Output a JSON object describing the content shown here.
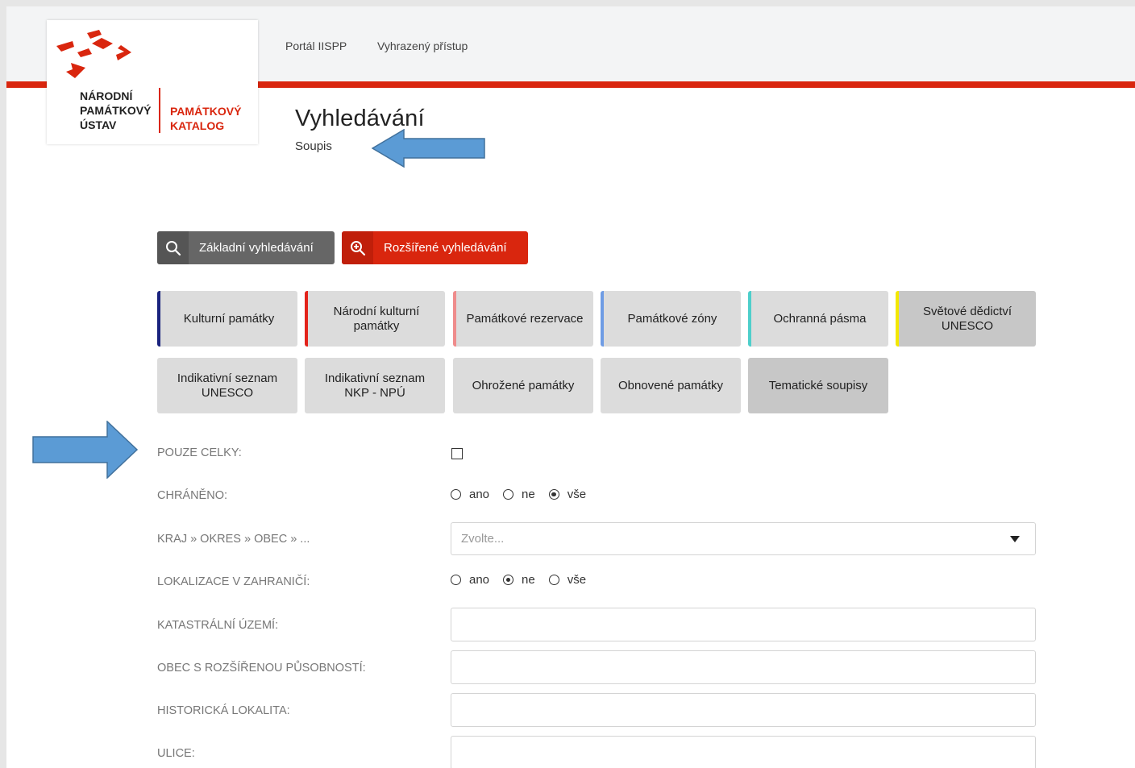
{
  "colors": {
    "brand_red": "#d9260e",
    "topbar_bg": "#f3f4f5",
    "callout_arrow": "#5b9bd5",
    "tile_bg": "#dcdcdc",
    "tile_dark_bg": "#c7c7c7"
  },
  "logo": {
    "line1": "NÁRODNÍ",
    "line2": "PAMÁTKOVÝ",
    "line3": "ÚSTAV",
    "sub1": "PAMÁTKOVÝ",
    "sub2": "KATALOG",
    "icon": "npu-logo-mark"
  },
  "nav": {
    "portal": "Portál IISPP",
    "restricted": "Vyhrazený přístup"
  },
  "header": {
    "title": "Vyhledávání",
    "subtitle": "Soupis"
  },
  "search_modes": {
    "basic": {
      "label": "Základní vyhledávání",
      "icon": "search-icon"
    },
    "advanced": {
      "label": "Rozšířené vyhledávání",
      "icon": "zoom-in-icon"
    }
  },
  "categories": [
    {
      "label": "Kulturní památky",
      "accent": "#1a237e"
    },
    {
      "label": "Národní kulturní památky",
      "accent": "#e3231b"
    },
    {
      "label": "Památkové rezervace",
      "accent": "#ef8c8c"
    },
    {
      "label": "Památkové zóny",
      "accent": "#6f9ce4"
    },
    {
      "label": "Ochranná pásma",
      "accent": "#4ecfcb"
    },
    {
      "label": "Světové dědictví UNESCO",
      "accent": "#f3e800"
    },
    {
      "label": "Indikativní seznam UNESCO",
      "accent": ""
    },
    {
      "label": "Indikativní seznam NKP - NPÚ",
      "accent": ""
    },
    {
      "label": "Ohrožené památky",
      "accent": ""
    },
    {
      "label": "Obnovené památky",
      "accent": ""
    },
    {
      "label": "Tematické soupisy",
      "accent": ""
    }
  ],
  "form": {
    "pouze_celky": {
      "label": "POUZE CELKY:",
      "checked": false
    },
    "chraneno": {
      "label": "CHRÁNĚNO:",
      "options": [
        "ano",
        "ne",
        "vše"
      ],
      "selected": "vše"
    },
    "kraj": {
      "label": "KRAJ » OKRES » OBEC » ...",
      "placeholder": "Zvolte..."
    },
    "lokalizace": {
      "label": "LOKALIZACE V ZAHRANIČÍ:",
      "options": [
        "ano",
        "ne",
        "vše"
      ],
      "selected": "ne"
    },
    "katastralni": {
      "label": "KATASTRÁLNÍ ÚZEMÍ:",
      "value": ""
    },
    "orp": {
      "label": "OBEC S ROZŠÍŘENOU PŮSOBNOSTÍ:",
      "value": ""
    },
    "historicka": {
      "label": "HISTORICKÁ LOKALITA:",
      "value": ""
    },
    "ulice": {
      "label": "ULICE:",
      "value": ""
    }
  }
}
